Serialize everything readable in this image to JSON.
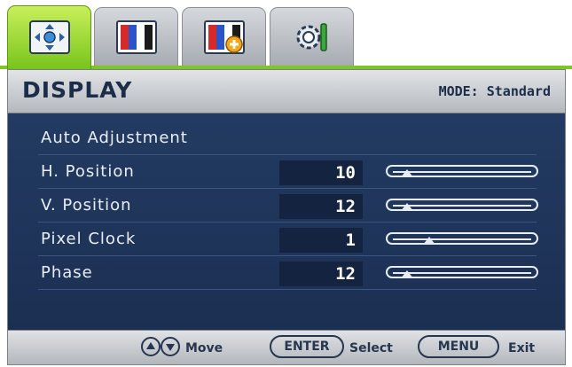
{
  "tabs": [
    {
      "name": "display-settings",
      "icon": "display-adjust-icon",
      "active": true
    },
    {
      "name": "picture",
      "icon": "color-bars-icon",
      "active": false
    },
    {
      "name": "picture-advanced",
      "icon": "color-bars-plus-icon",
      "active": false
    },
    {
      "name": "system",
      "icon": "gear-wrench-icon",
      "active": false
    }
  ],
  "header": {
    "title": "DISPLAY",
    "mode": "MODE: Standard"
  },
  "menu": {
    "items": [
      {
        "label": "Auto Adjustment"
      },
      {
        "label": "H. Position",
        "value": "10",
        "level": 0.1
      },
      {
        "label": "V. Position",
        "value": "12",
        "level": 0.1
      },
      {
        "label": "Pixel Clock",
        "value": "1",
        "level": 0.26
      },
      {
        "label": "Phase",
        "value": "12",
        "level": 0.1
      }
    ]
  },
  "footer": {
    "move_label": "Move",
    "enter_key": "ENTER",
    "select_label": "Select",
    "menu_key": "MENU",
    "exit_label": "Exit"
  },
  "colors": {
    "active_tab": "#7ec526",
    "menu_bg": "#233b62",
    "value_bg": "#14233f",
    "text_dark": "#1c2d4a"
  }
}
